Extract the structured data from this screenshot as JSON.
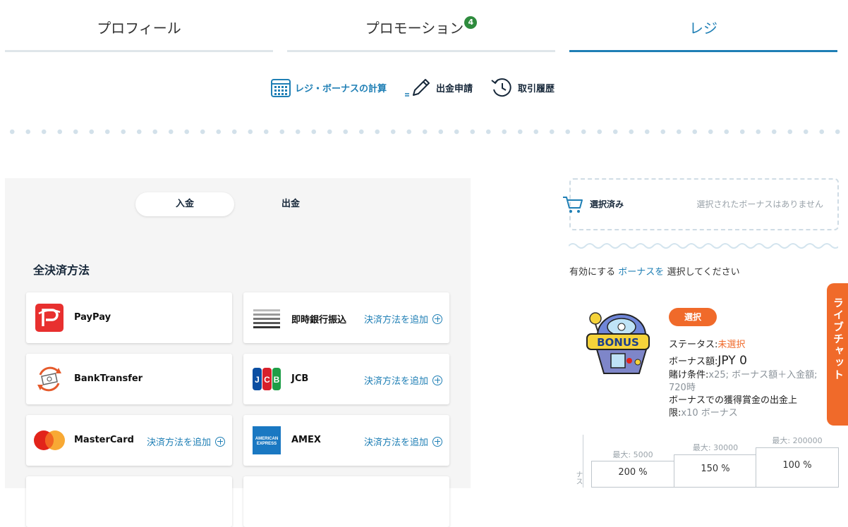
{
  "tabs": [
    {
      "label": "プロフィール"
    },
    {
      "label": "プロモーション",
      "badge": "4"
    },
    {
      "label": "レジ",
      "active": true
    }
  ],
  "subnav": {
    "calculator": "レジ・ボーナスの計算",
    "withdraw_request": "出金申請",
    "history": "取引履歴"
  },
  "cashier": {
    "toggle_deposit": "入金",
    "toggle_withdraw": "出金",
    "section_title": "全決済方法",
    "add_label": "決済方法を追加",
    "methods": [
      {
        "name": "PayPay",
        "logo": "paypay-logo",
        "has_add": false
      },
      {
        "name": "即時銀行振込",
        "logo": "bank-transfer-stripes-logo",
        "has_add": true
      },
      {
        "name": "BankTransfer",
        "logo": "bank-transfer-logo",
        "has_add": false
      },
      {
        "name": "JCB",
        "logo": "jcb-logo",
        "has_add": true
      },
      {
        "name": "MasterCard",
        "logo": "mastercard-logo",
        "has_add": true
      },
      {
        "name": "AMEX",
        "logo": "amex-logo",
        "has_add": true
      }
    ]
  },
  "selected": {
    "label": "選択済み",
    "empty_text": "選択されたボーナスはありません"
  },
  "prompt": {
    "prefix": "有効にする",
    "link": "ボーナスを",
    "suffix": "選択してください"
  },
  "bonus": {
    "select_button": "選択",
    "status_label": "ステータス:",
    "status_value": "未選択",
    "amount_label": "ボーナス額:",
    "amount_value": "JPY 0",
    "wager_label": "賭け条件:",
    "wager_value": "x25; ボーナス額＋入金額; 720時",
    "cap_label": "ボーナスでの獲得賞金の出金上限:",
    "cap_value": "x10 ボーナス",
    "tiers": [
      {
        "max_label": "最大: 5000",
        "percent": "200 %"
      },
      {
        "max_label": "最大: 30000",
        "percent": "150 %"
      },
      {
        "max_label": "最大: 200000",
        "percent": "100 %"
      }
    ],
    "axis_label": "ナス"
  },
  "live_chat": {
    "label": "ライブチャット"
  },
  "colors": {
    "accent": "#1f7fb5",
    "orange": "#f06a2a",
    "badge_green": "#2e8b3d"
  }
}
